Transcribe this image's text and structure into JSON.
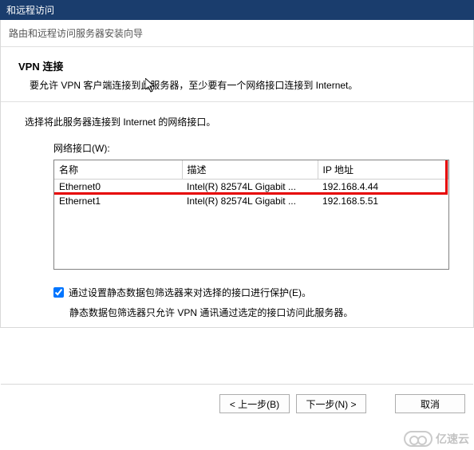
{
  "window": {
    "title": "和远程访问",
    "wizard_subtitle": "路由和远程访问服务器安装向导"
  },
  "header": {
    "title": "VPN 连接",
    "desc": "要允许 VPN 客户端连接到此服务器，至少要有一个网络接口连接到 Internet。"
  },
  "content": {
    "instruction": "选择将此服务器连接到 Internet 的网络接口。",
    "iface_label": "网络接口(W):"
  },
  "table": {
    "cols": {
      "name": "名称",
      "desc": "描述",
      "ip": "IP 地址"
    },
    "rows": [
      {
        "name": "Ethernet0",
        "desc": "Intel(R) 82574L Gigabit ...",
        "ip": "192.168.4.44"
      },
      {
        "name": "Ethernet1",
        "desc": "Intel(R) 82574L Gigabit ...",
        "ip": "192.168.5.51"
      }
    ]
  },
  "protect": {
    "checkbox_label": "通过设置静态数据包筛选器来对选择的接口进行保护(E)。",
    "desc": "静态数据包筛选器只允许 VPN 通讯通过选定的接口访问此服务器。"
  },
  "buttons": {
    "back": "< 上一步(B)",
    "next": "下一步(N) >",
    "cancel": "取消"
  },
  "watermark": {
    "text": "亿速云"
  }
}
